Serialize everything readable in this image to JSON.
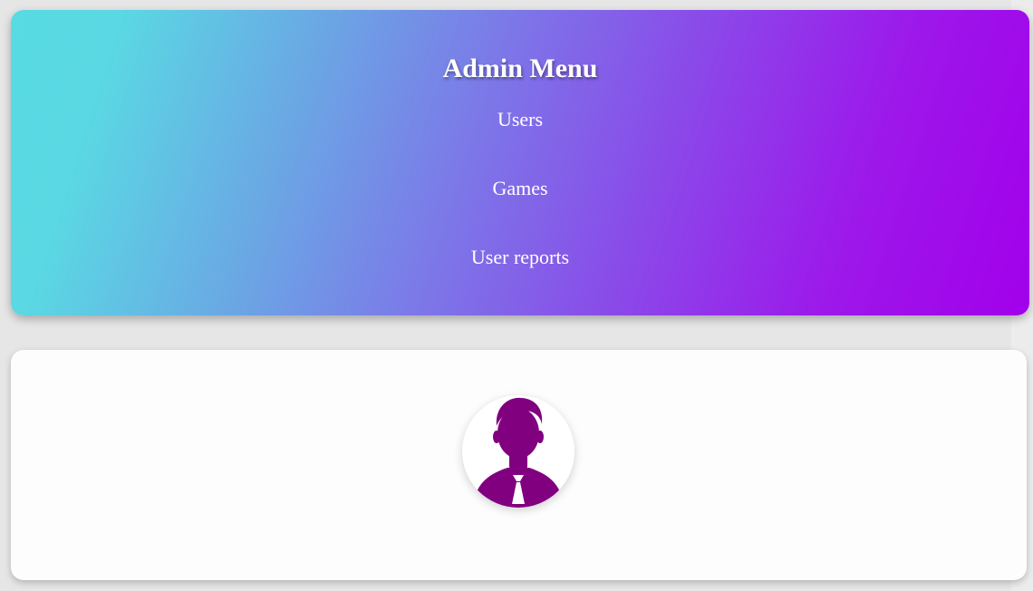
{
  "admin_menu": {
    "title": "Admin Menu",
    "items": [
      {
        "label": "Users"
      },
      {
        "label": "Games"
      },
      {
        "label": "User reports"
      }
    ]
  },
  "profile": {
    "avatar_icon": "user-silhouette-icon",
    "avatar_color": "#800080"
  },
  "colors": {
    "gradient_start": "#58dbe3",
    "gradient_end": "#a200eb",
    "text": "#ffffff",
    "background": "#e6e6e6"
  }
}
